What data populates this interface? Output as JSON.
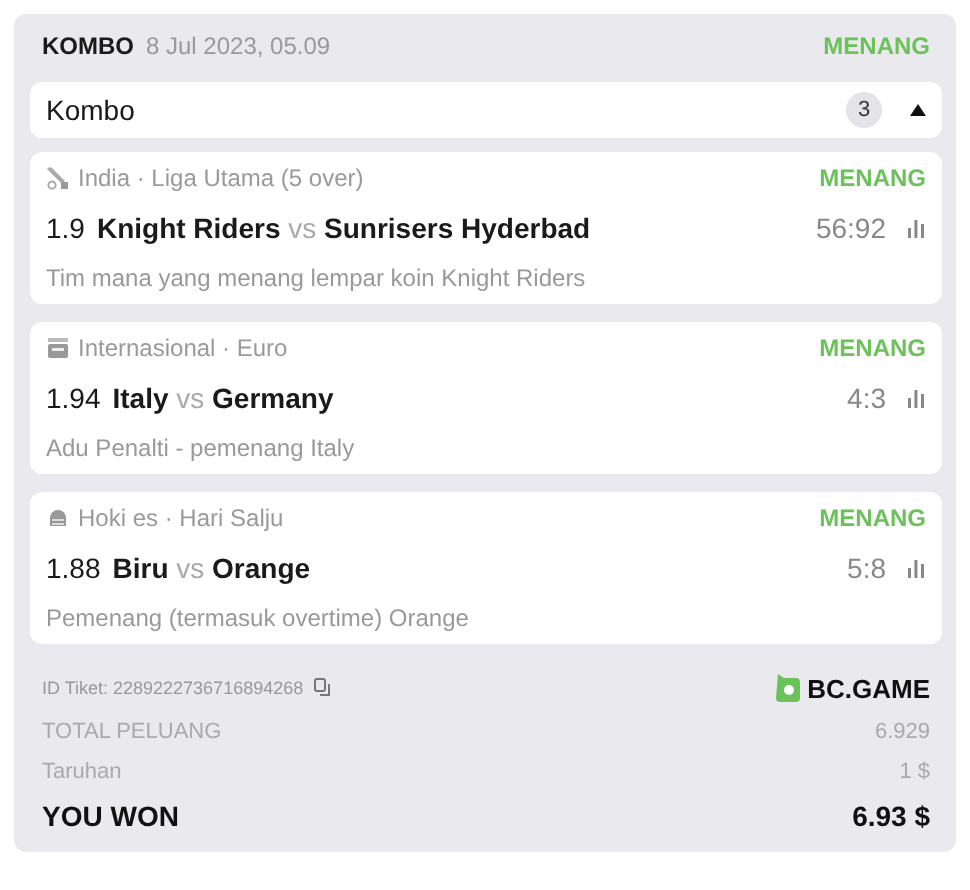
{
  "header": {
    "type": "KOMBO",
    "date": "8 Jul 2023, 05.09",
    "status": "MENANG"
  },
  "group": {
    "title": "Kombo",
    "count": "3",
    "expanded": true
  },
  "legs": [
    {
      "league": "India · Liga Utama (5 over)",
      "status": "MENANG",
      "odds": "1.9",
      "home": "Knight Riders",
      "vs": "vs",
      "away": "Sunrisers Hyderbad",
      "score": "56:92",
      "market": "Tim mana yang menang lempar koin Knight Riders"
    },
    {
      "league": "Internasional · Euro",
      "status": "MENANG",
      "odds": "1.94",
      "home": "Italy",
      "vs": "vs",
      "away": "Germany",
      "score": "4:3",
      "market": "Adu Penalti - pemenang Italy"
    },
    {
      "league": "Hoki es · Hari Salju",
      "status": "MENANG",
      "odds": "1.88",
      "home": "Biru",
      "vs": "vs",
      "away": "Orange",
      "score": "5:8",
      "market": "Pemenang (termasuk overtime) Orange"
    }
  ],
  "ticket": {
    "label": "ID Tiket:",
    "id": "2289222736716894268",
    "brand": "BC.GAME"
  },
  "totals": [
    {
      "label": "TOTAL PELUANG",
      "value": "6.929",
      "kind": "plain"
    },
    {
      "label": "Taruhan",
      "value": "1 $",
      "kind": "plain"
    },
    {
      "label": "YOU WON",
      "value": "6.93 $",
      "kind": "result"
    }
  ]
}
